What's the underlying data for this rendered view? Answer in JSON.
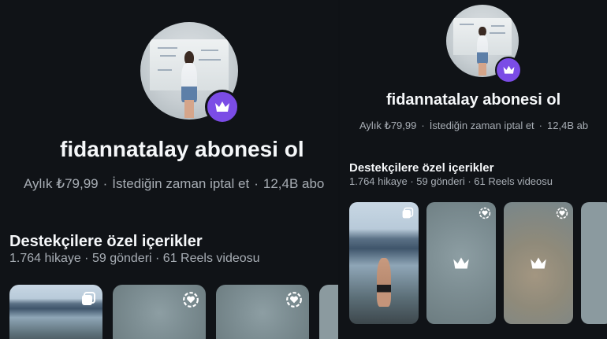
{
  "profile": {
    "title": "fidannatalay abonesi ol",
    "price": "Aylık ₺79,99",
    "cancel_note": "İstediğin zaman iptal et",
    "subscribers_left": "12,4B abo",
    "subscribers_right": "12,4B ab",
    "separator": "·",
    "badge_icon": "crown-icon"
  },
  "exclusive": {
    "title": "Destekçilere özel içerikler",
    "stats": "1.764 hikaye · 59 gönderi · 61 Reels videosu"
  },
  "tiles": [
    {
      "type": "photo",
      "icon": "multi-post-icon"
    },
    {
      "type": "locked",
      "icon": "story-ring-icon"
    },
    {
      "type": "locked",
      "icon": "story-ring-icon"
    }
  ],
  "colors": {
    "background": "#101317",
    "badge": "#7b4ce6",
    "text": "#f5f7f9",
    "muted": "#a7adb4"
  }
}
